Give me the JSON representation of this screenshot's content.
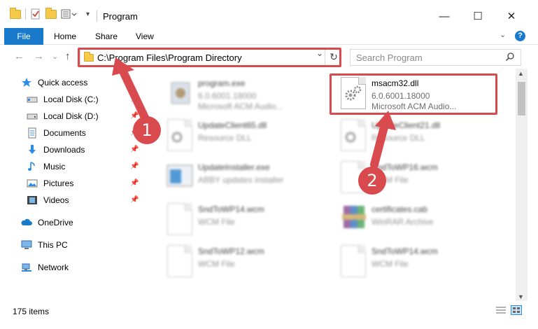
{
  "window": {
    "title": "Program",
    "minimize_glyph": "—",
    "maximize_glyph": "☐",
    "close_glyph": "✕"
  },
  "ribbon": {
    "file_tab": "File",
    "tabs": [
      "Home",
      "Share",
      "View"
    ],
    "help_glyph": "?",
    "expand_glyph": "⌄"
  },
  "nav": {
    "back_glyph": "←",
    "forward_glyph": "→",
    "recent_glyph": "⌄",
    "up_glyph": "↑",
    "address": "C:\\Program Files\\Program Directory",
    "refresh_glyph": "↻",
    "search_placeholder": "Search Program",
    "search_glyph": "⚲"
  },
  "sidebar": {
    "items": [
      {
        "label": "Quick access",
        "icon": "star-icon",
        "pinned": false
      },
      {
        "label": "Local Disk (C:)",
        "icon": "drive-icon",
        "pinned": true
      },
      {
        "label": "Local Disk (D:)",
        "icon": "drive-icon",
        "pinned": true
      },
      {
        "label": "Documents",
        "icon": "documents-icon",
        "pinned": true
      },
      {
        "label": "Downloads",
        "icon": "downloads-icon",
        "pinned": true
      },
      {
        "label": "Music",
        "icon": "music-icon",
        "pinned": true
      },
      {
        "label": "Pictures",
        "icon": "pictures-icon",
        "pinned": true
      },
      {
        "label": "Videos",
        "icon": "videos-icon",
        "pinned": true
      },
      {
        "label": "OneDrive",
        "icon": "cloud-icon",
        "pinned": false
      },
      {
        "label": "This PC",
        "icon": "pc-icon",
        "pinned": false,
        "selected": true
      },
      {
        "label": "Network",
        "icon": "network-icon",
        "pinned": false
      }
    ]
  },
  "files": [
    {
      "name": "program.exe",
      "line2": "6.0.6001.18000",
      "line3": "Microsoft ACM Audio...",
      "blurred": true,
      "icon": "exe-icon"
    },
    {
      "name": "msacm32.dll",
      "line2": "6.0.6001.18000",
      "line3": "Microsoft ACM Audio...",
      "blurred": false,
      "icon": "dll-gear-icon"
    },
    {
      "name": "UpdateClient65.dll",
      "line2": "Resource DLL",
      "line3": "",
      "blurred": true,
      "icon": "dll-gear-icon"
    },
    {
      "name": "UpdateClient21.dll",
      "line2": "Resource DLL",
      "line3": "",
      "blurred": true,
      "icon": "dll-gear-icon"
    },
    {
      "name": "UpdateInstaller.exe",
      "line2": "ABBY updates installer",
      "line3": "",
      "blurred": true,
      "icon": "installer-icon"
    },
    {
      "name": "SndToWP16.wcm",
      "line2": "WCM File",
      "line3": "",
      "blurred": true,
      "icon": "file-icon"
    },
    {
      "name": "SndToWP14.wcm",
      "line2": "WCM File",
      "line3": "",
      "blurred": true,
      "icon": "file-icon"
    },
    {
      "name": "certificates.cab",
      "line2": "WinRAR Archive",
      "line3": "",
      "blurred": true,
      "icon": "archive-icon"
    },
    {
      "name": "SndToWP12.wcm",
      "line2": "WCM File",
      "line3": "",
      "blurred": true,
      "icon": "file-icon"
    },
    {
      "name": "SndToWP14.wcm",
      "line2": "WCM File",
      "line3": "",
      "blurred": true,
      "icon": "file-icon"
    }
  ],
  "status": {
    "item_count": "175 items"
  },
  "annotations": {
    "step1": "1",
    "step2": "2",
    "highlight_color": "#d94a4f"
  },
  "colors": {
    "accent": "#1979ca",
    "selection": "#d9d9d9"
  }
}
